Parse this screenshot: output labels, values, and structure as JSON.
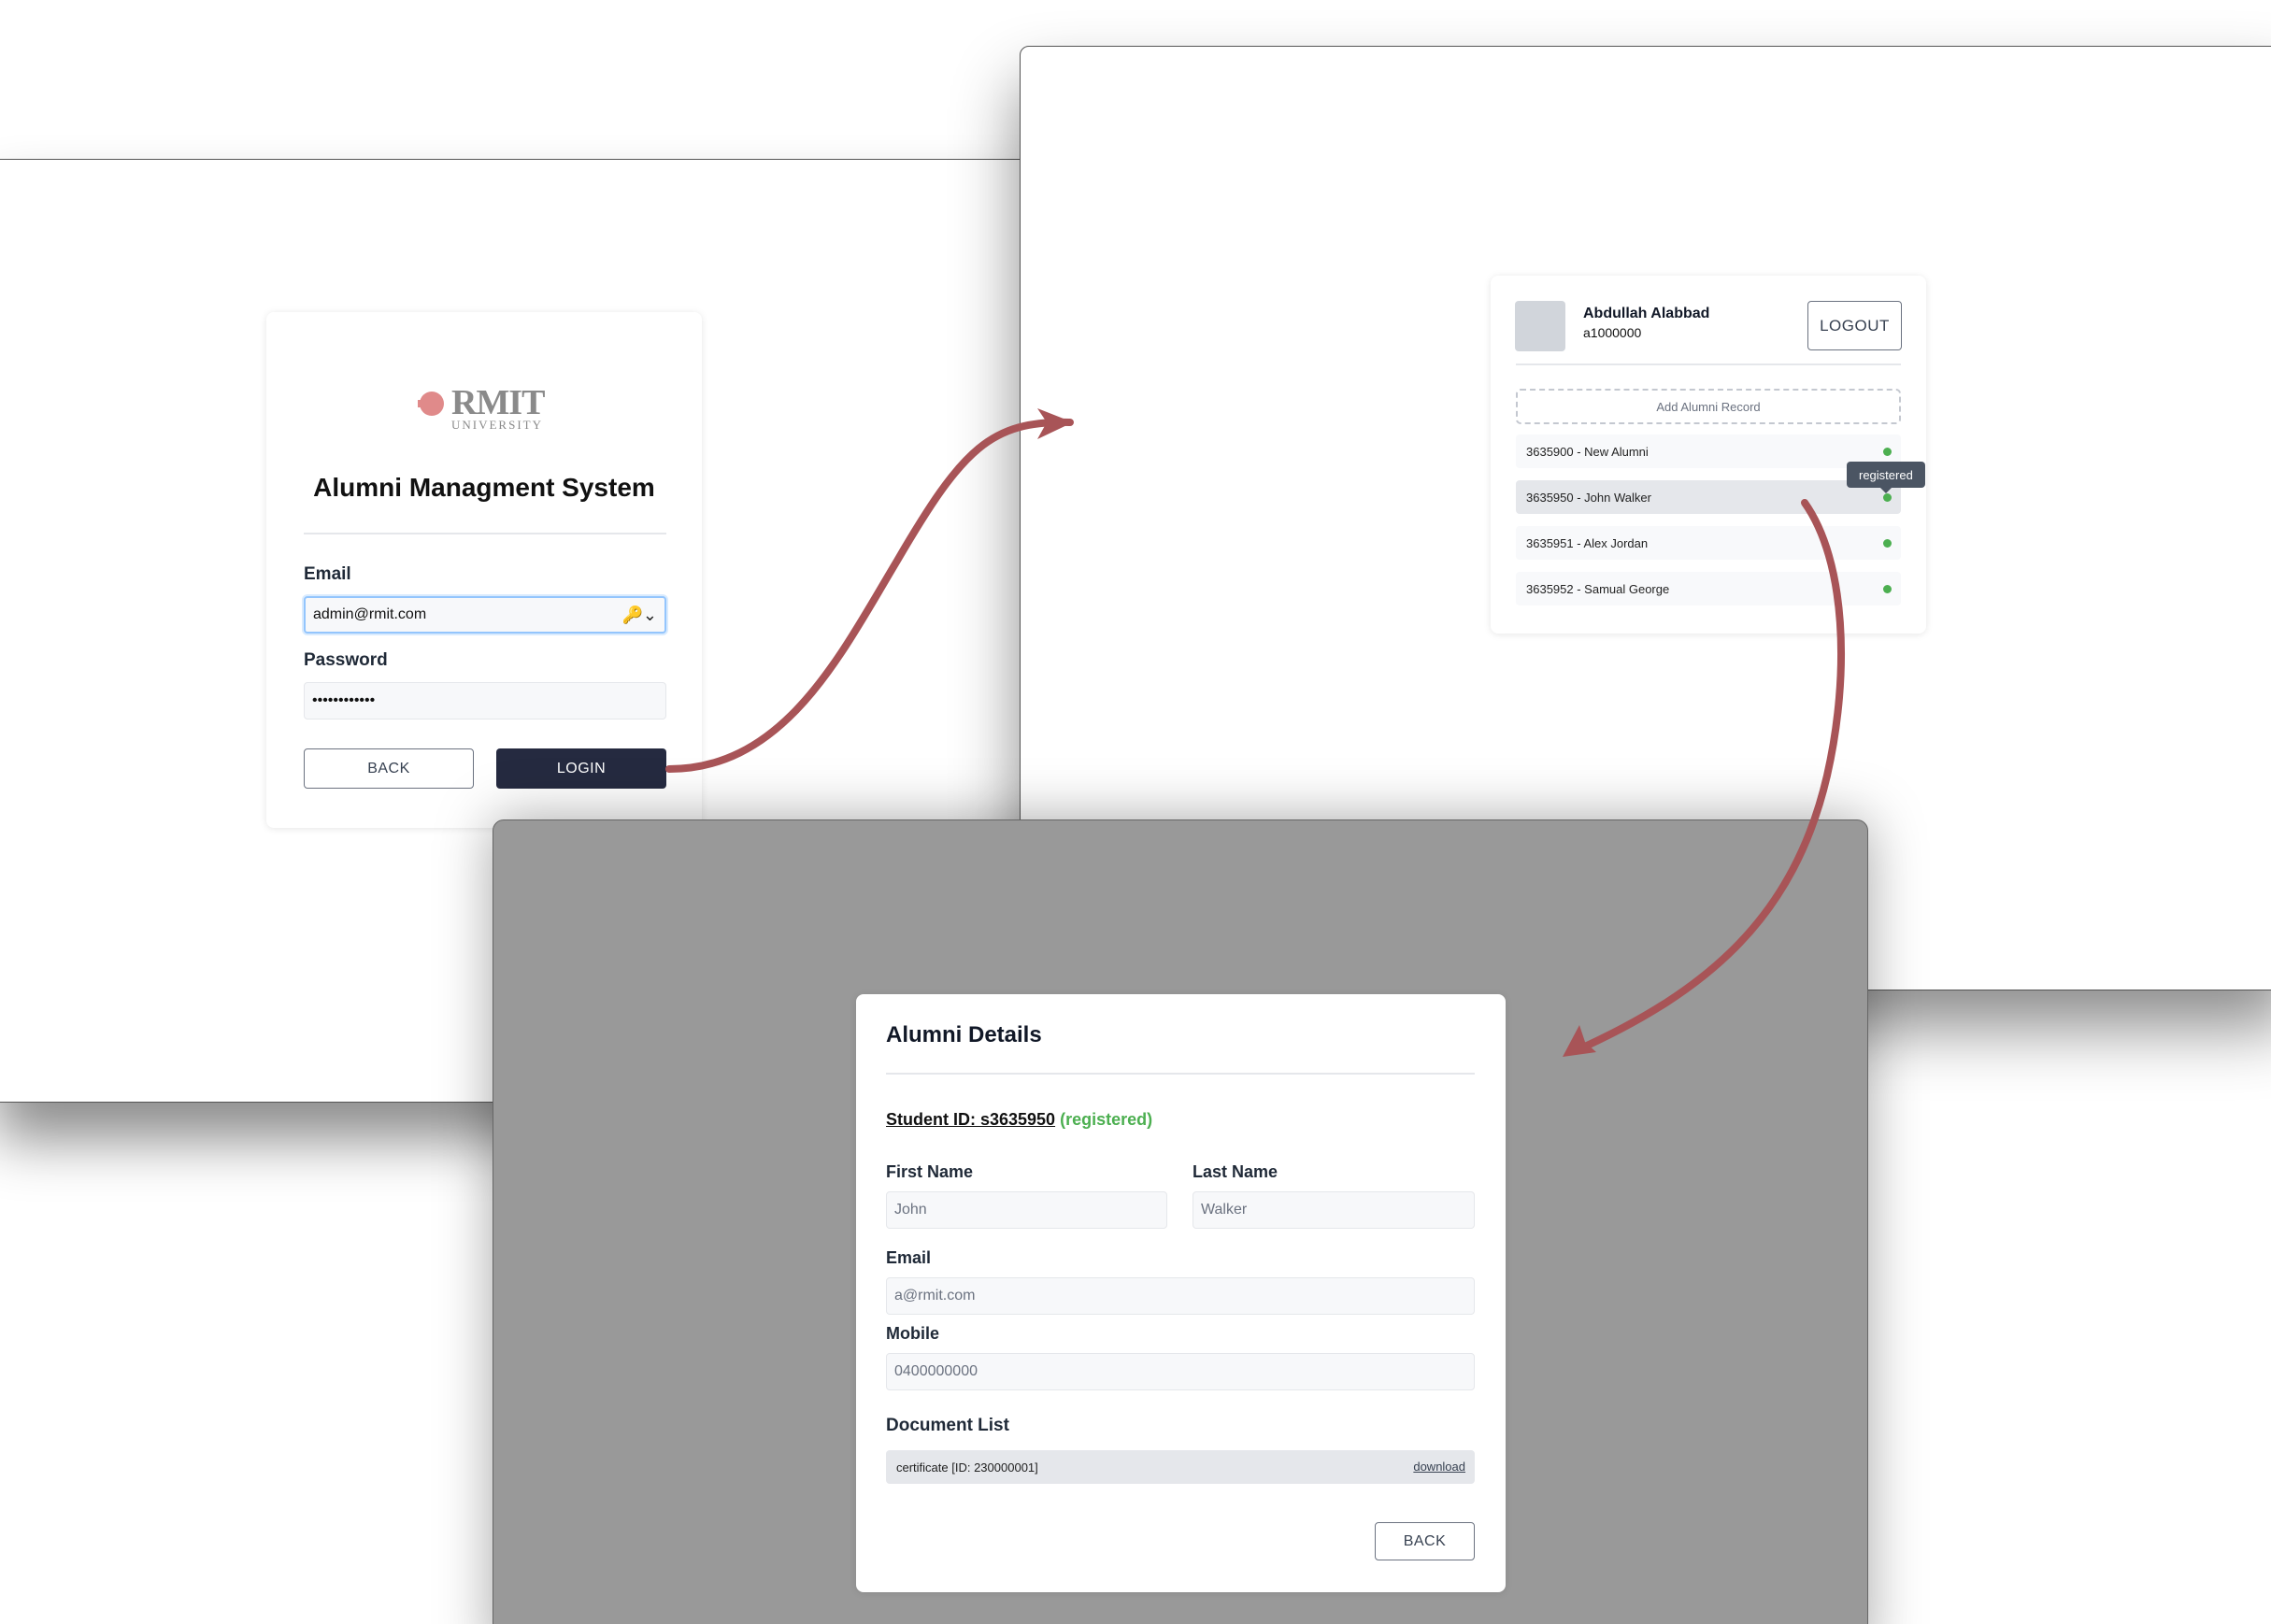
{
  "login": {
    "logo": {
      "wordmark": "RMIT",
      "subtext": "UNIVERSITY"
    },
    "title": "Alumni Managment System",
    "email_label": "Email",
    "email_value": "admin@rmit.com",
    "password_label": "Password",
    "password_value": "••••••••••••",
    "back_label": "BACK",
    "login_label": "LOGIN",
    "key_icon": "key-icon"
  },
  "dashboard": {
    "user_name": "Abdullah Alabbad",
    "user_id": "a1000000",
    "logout_label": "LOGOUT",
    "add_record_label": "Add Alumni Record",
    "records": [
      {
        "label": "3635900 - New Alumni",
        "status_color": "#4caf50"
      },
      {
        "label": "3635950 - John Walker",
        "status_color": "#4caf50"
      },
      {
        "label": "3635951 - Alex Jordan",
        "status_color": "#4caf50"
      },
      {
        "label": "3635952 - Samual George",
        "status_color": "#4caf50"
      }
    ],
    "tooltip": "registered"
  },
  "details": {
    "title": "Alumni Details",
    "student_id": "Student ID: s3635950",
    "status": "(registered)",
    "first_name_label": "First Name",
    "first_name": "John",
    "last_name_label": "Last Name",
    "last_name": "Walker",
    "email_label": "Email",
    "email": "a@rmit.com",
    "mobile_label": "Mobile",
    "mobile": "0400000000",
    "documents_label": "Document List",
    "documents": [
      {
        "name": "certificate [ID: 230000001]",
        "action": "download"
      }
    ],
    "back_label": "BACK"
  },
  "colors": {
    "arrow": "#a85457",
    "primary_button": "#252a40",
    "status_green": "#4caf50",
    "overlay": "#999999"
  }
}
